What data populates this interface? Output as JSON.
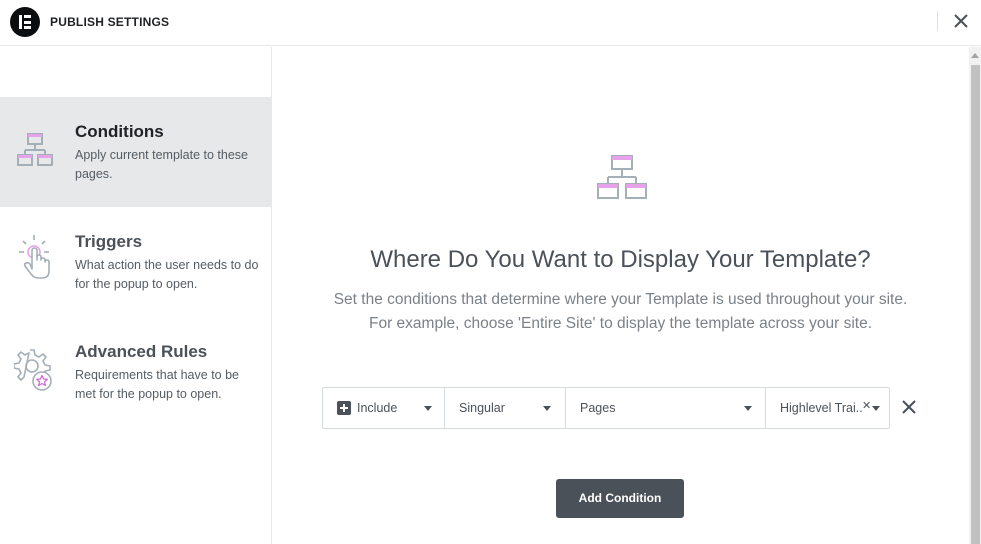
{
  "header": {
    "title": "PUBLISH SETTINGS"
  },
  "sidebar": {
    "tabs": [
      {
        "title": "Conditions",
        "description": "Apply current template to these pages.",
        "icon": "sitemap-icon",
        "active": true
      },
      {
        "title": "Triggers",
        "description": "What action the user needs to do for the popup to open.",
        "icon": "pointer-click-icon",
        "active": false
      },
      {
        "title": "Advanced Rules",
        "description": "Requirements that have to be met for the popup to open.",
        "icon": "gear-star-icon",
        "active": false
      }
    ]
  },
  "main": {
    "title": "Where Do You Want to Display Your Template?",
    "description_line1": "Set the conditions that determine where your Template is used throughout your site.",
    "description_line2": "For example, choose 'Entire Site' to display the template across your site.",
    "condition": {
      "type": "Include",
      "category": "Singular",
      "subcategory": "Pages",
      "value": "Highlevel Trai..."
    },
    "add_button": "Add Condition"
  },
  "colors": {
    "accent": "#d004d4",
    "icon_gray": "#a4afb7",
    "button_bg": "#4b5158",
    "active_tab_bg": "#e6e8ea"
  }
}
